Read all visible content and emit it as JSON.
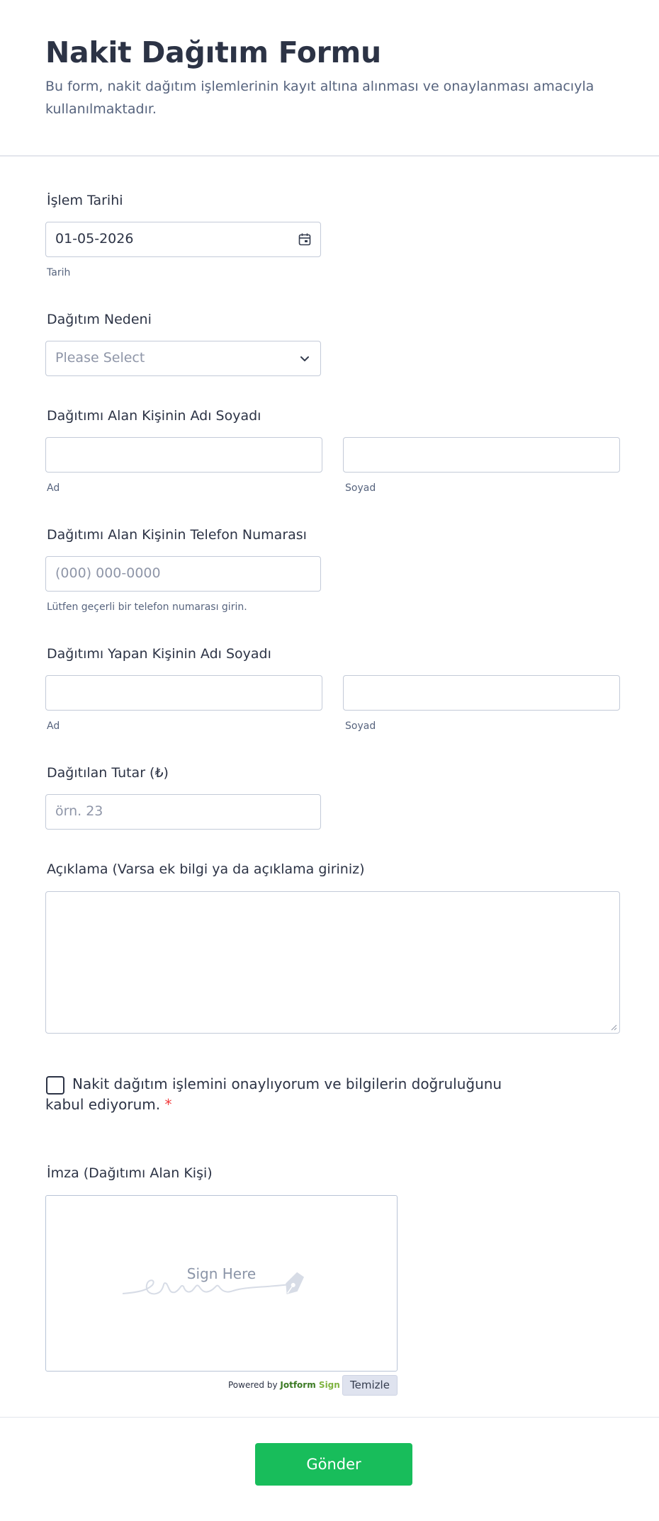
{
  "form": {
    "title": "Nakit Dağıtım Formu",
    "description": "Bu form, nakit dağıtım işlemlerinin kayıt altına alınması ve onaylanması amacıyla kullanılmaktadır."
  },
  "fields": {
    "date": {
      "label": "İşlem Tarihi",
      "value": "01-05-2026",
      "sublabel": "Tarih",
      "icon": "calendar-icon"
    },
    "reason": {
      "label": "Dağıtım Nedeni",
      "placeholder": "Please Select",
      "icon": "chevron-down-icon"
    },
    "recipient_name": {
      "label": "Dağıtımı Alan Kişinin Adı Soyadı",
      "first_sublabel": "Ad",
      "last_sublabel": "Soyad"
    },
    "recipient_phone": {
      "label": "Dağıtımı Alan Kişinin Telefon Numarası",
      "placeholder": "(000) 000-0000",
      "sublabel": "Lütfen geçerli bir telefon numarası girin."
    },
    "distributor_name": {
      "label": "Dağıtımı Yapan Kişinin Adı Soyadı",
      "first_sublabel": "Ad",
      "last_sublabel": "Soyad"
    },
    "amount": {
      "label": "Dağıtılan Tutar (₺)",
      "placeholder": "örn. 23"
    },
    "description": {
      "label": "Açıklama (Varsa ek bilgi ya da açıklama giriniz)"
    },
    "consent": {
      "text": "Nakit dağıtım işlemini onaylıyorum ve bilgilerin doğruluğunu kabul ediyorum.",
      "required_mark": "*"
    },
    "signature": {
      "label": "İmza (Dağıtımı Alan Kişi)",
      "prompt": "Sign Here",
      "powered_by": "Powered by",
      "brand_main": "Jotform",
      "brand_sub": "Sign",
      "clear_label": "Temizle"
    }
  },
  "submit_label": "Gönder",
  "colors": {
    "accent": "#18bd5b",
    "border": "#c3cad8",
    "text": "#2c3345",
    "muted": "#57647e",
    "required": "#f23a3c"
  }
}
